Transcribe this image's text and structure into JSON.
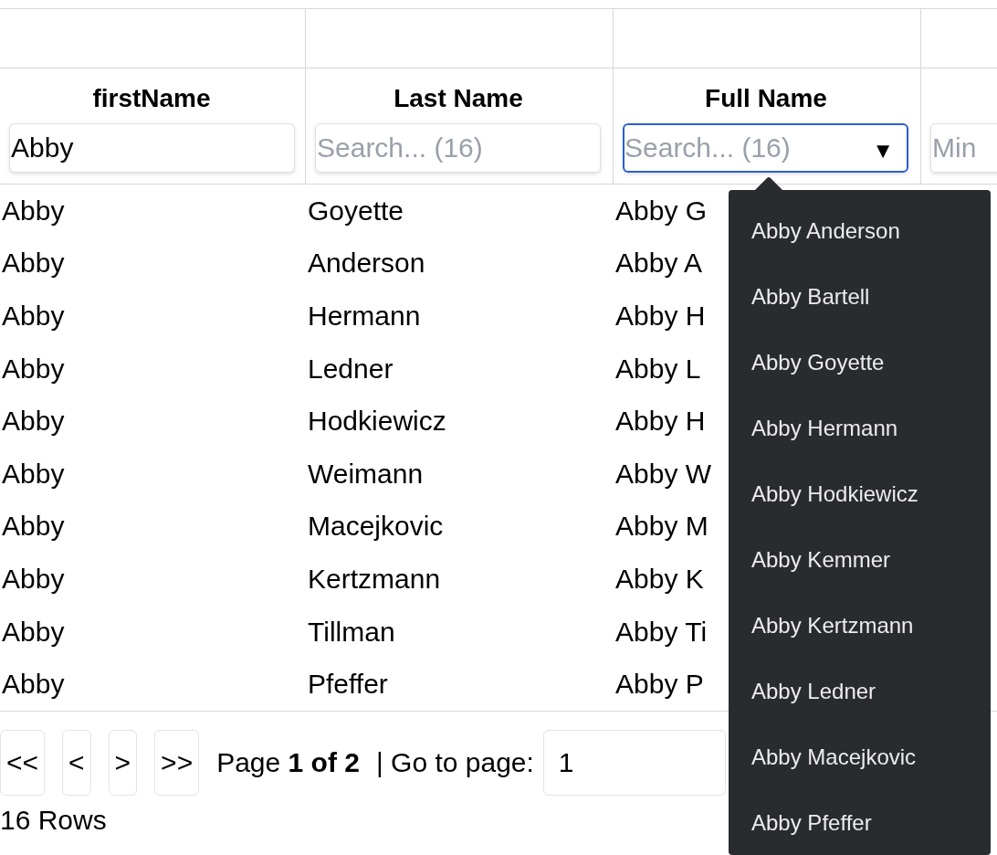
{
  "table": {
    "columns": [
      {
        "title": "firstName",
        "filter": {
          "kind": "text",
          "value": "Abby",
          "focused": false
        }
      },
      {
        "title": "Last Name",
        "filter": {
          "kind": "text",
          "placeholder": "Search... (16)",
          "focused": false
        }
      },
      {
        "title": "Full Name",
        "filter": {
          "kind": "combo",
          "placeholder": "Search... (16)",
          "focused": true,
          "toggle": "▼"
        }
      },
      {
        "filter": {
          "kind": "text",
          "placeholder": "Min",
          "focused": false
        }
      }
    ],
    "rows": [
      [
        "Abby",
        "Goyette",
        "Abby G"
      ],
      [
        "Abby",
        "Anderson",
        "Abby A"
      ],
      [
        "Abby",
        "Hermann",
        "Abby H"
      ],
      [
        "Abby",
        "Ledner",
        "Abby L"
      ],
      [
        "Abby",
        "Hodkiewicz",
        "Abby H"
      ],
      [
        "Abby",
        "Weimann",
        "Abby W"
      ],
      [
        "Abby",
        "Macejkovic",
        "Abby M"
      ],
      [
        "Abby",
        "Kertzmann",
        "Abby K"
      ],
      [
        "Abby",
        "Tillman",
        "Abby Ti"
      ],
      [
        "Abby",
        "Pfeffer",
        "Abby P"
      ]
    ]
  },
  "pagination": {
    "buttons": [
      "<<",
      "<",
      ">",
      ">>"
    ],
    "page_text": "Page **1 of 2**",
    "goto_label": "| Go to page:",
    "goto_value": "1",
    "row_count": "16 Rows"
  },
  "dropdown": {
    "items": [
      "Abby Anderson",
      "Abby Bartell",
      "Abby Goyette",
      "Abby Hermann",
      "Abby Hodkiewicz",
      "Abby Kemmer",
      "Abby Kertzmann",
      "Abby Ledner",
      "Abby Macejkovic",
      "Abby Pfeffer"
    ]
  }
}
